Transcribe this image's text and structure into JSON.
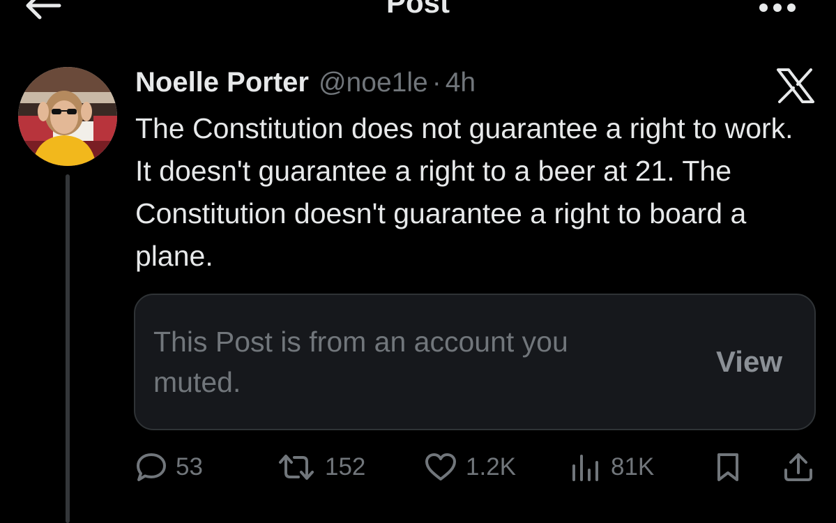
{
  "header": {
    "title": "Post",
    "back_icon": "arrow-left-icon",
    "more_icon": "more-horizontal-icon"
  },
  "post": {
    "author": {
      "display_name": "Noelle Porter",
      "handle": "@noe1le",
      "avatar_icon": "avatar-photo"
    },
    "separator": "·",
    "time": "4h",
    "platform_icon": "x-logo-icon",
    "text": "The Constitution does not guarantee a right to work. It doesn't guarantee a right to a beer at 21. The Constitution doesn't guarantee a right to board a plane.",
    "muted_notice": {
      "text": "This Post is from an account you muted.",
      "action_label": "View"
    },
    "actions": {
      "replies": "53",
      "reposts": "152",
      "likes": "1.2K",
      "views": "81K"
    }
  },
  "colors": {
    "background": "#000000",
    "text_primary": "#e7e9ea",
    "text_secondary": "#71767b",
    "card_background": "#16181c",
    "card_border": "#2f3336"
  }
}
